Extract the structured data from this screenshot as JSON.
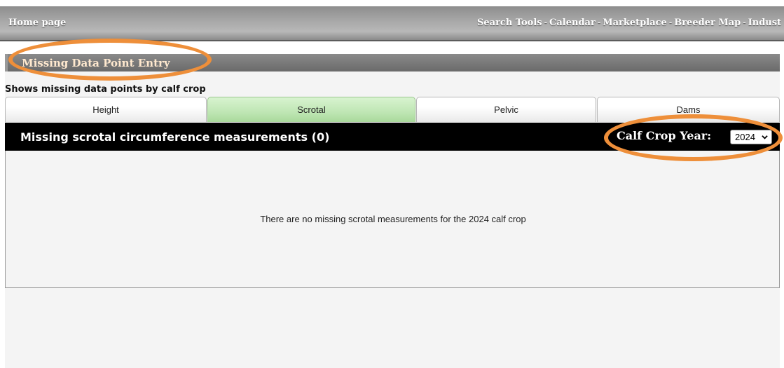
{
  "nav": {
    "home": "Home page",
    "links": [
      "Search Tools",
      "Calendar",
      "Marketplace",
      "Breeder Map",
      "Indust"
    ],
    "separator": "-"
  },
  "section": {
    "title": "Missing Data Point Entry",
    "subtitle": "Shows missing data points by calf crop"
  },
  "tabs": [
    {
      "label": "Height",
      "active": false
    },
    {
      "label": "Scrotal",
      "active": true
    },
    {
      "label": "Pelvic",
      "active": false
    },
    {
      "label": "Dams",
      "active": false
    }
  ],
  "data_panel": {
    "title": "Missing scrotal circumference measurements (0)",
    "year_label": "Calf Crop Year:",
    "year_value": "2024",
    "empty_message": "There are no missing scrotal measurements for the 2024 calf crop"
  },
  "colors": {
    "highlight": "#ee8f3a",
    "active_tab": "#bfe6b4",
    "header_bg": "#000000"
  },
  "icons": {
    "year_dropdown": "chevron-down-icon"
  }
}
